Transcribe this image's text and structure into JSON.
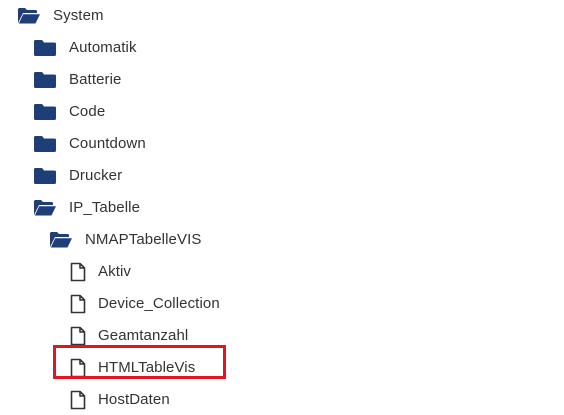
{
  "tree": {
    "system": {
      "label": "System",
      "icon": "folder-open-icon"
    },
    "automatik": {
      "label": "Automatik",
      "icon": "folder-icon"
    },
    "batterie": {
      "label": "Batterie",
      "icon": "folder-icon"
    },
    "code": {
      "label": "Code",
      "icon": "folder-icon"
    },
    "countdown": {
      "label": "Countdown",
      "icon": "folder-icon"
    },
    "drucker": {
      "label": "Drucker",
      "icon": "folder-icon"
    },
    "ip_tabelle": {
      "label": "IP_Tabelle",
      "icon": "folder-open-icon"
    },
    "nmaptabellevis": {
      "label": "NMAPTabelleVIS",
      "icon": "folder-open-icon"
    },
    "aktiv": {
      "label": "Aktiv",
      "icon": "file-icon"
    },
    "device_collection": {
      "label": "Device_Collection",
      "icon": "file-icon"
    },
    "geamtanzahl": {
      "label": "Geamtanzahl",
      "icon": "file-icon"
    },
    "htmltablevis": {
      "label": "HTMLTableVis",
      "icon": "file-icon",
      "highlighted": true
    },
    "hostdaten": {
      "label": "HostDaten",
      "icon": "file-icon"
    }
  },
  "colors": {
    "folder": "#1f3e77",
    "file_stroke": "#333333",
    "text": "#333333",
    "highlight": "#e3131f"
  }
}
